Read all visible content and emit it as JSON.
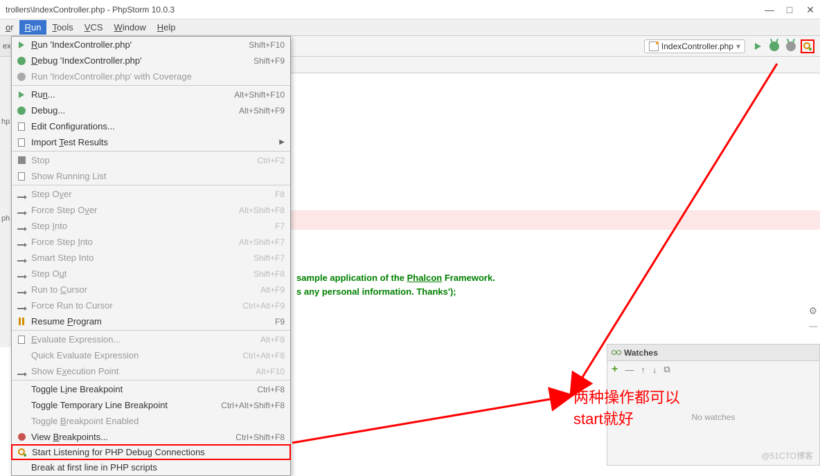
{
  "window": {
    "title": "trollers\\IndexController.php - PhpStorm 10.0.3"
  },
  "menubar": {
    "items": [
      "or",
      "Run",
      "Tools",
      "VCS",
      "Window",
      "Help"
    ],
    "active_index": 1
  },
  "toolbar": {
    "left_tab": "exC",
    "run_config": "IndexController.php"
  },
  "left_rail": {
    "labels": [
      "hp",
      "ph"
    ]
  },
  "dropdown": {
    "items": [
      {
        "icon": "play",
        "label": "Run 'IndexController.php'",
        "shortcut": "Shift+F10",
        "u": [
          0
        ]
      },
      {
        "icon": "bug",
        "label": "Debug 'IndexController.php'",
        "shortcut": "Shift+F9",
        "u": [
          0
        ]
      },
      {
        "icon": "bug-gray",
        "label": "Run 'IndexController.php' with Coverage",
        "disabled": true
      },
      {
        "sep": true
      },
      {
        "icon": "play",
        "label": "Run...",
        "shortcut": "Alt+Shift+F10",
        "u": [
          2
        ]
      },
      {
        "icon": "bug",
        "label": "Debug...",
        "shortcut": "Alt+Shift+F9",
        "u": [
          4
        ]
      },
      {
        "icon": "doc",
        "label": "Edit Configurations...",
        "u": [
          10
        ]
      },
      {
        "icon": "doc",
        "label": "Import Test Results",
        "sub": true,
        "u": [
          7
        ]
      },
      {
        "sep": true
      },
      {
        "icon": "sq",
        "label": "Stop",
        "shortcut": "Ctrl+F2",
        "disabled": true,
        "u": [
          4
        ]
      },
      {
        "icon": "doc",
        "label": "Show Running List",
        "disabled": true
      },
      {
        "sep": true
      },
      {
        "icon": "step",
        "label": "Step Over",
        "shortcut": "F8",
        "disabled": true,
        "u": [
          6
        ]
      },
      {
        "icon": "step",
        "label": "Force Step Over",
        "shortcut": "Alt+Shift+F8",
        "disabled": true,
        "u": [
          12
        ]
      },
      {
        "icon": "step",
        "label": "Step Into",
        "shortcut": "F7",
        "disabled": true,
        "u": [
          5
        ]
      },
      {
        "icon": "step",
        "label": "Force Step Into",
        "shortcut": "Alt+Shift+F7",
        "disabled": true,
        "u": [
          11
        ]
      },
      {
        "icon": "step",
        "label": "Smart Step Into",
        "shortcut": "Shift+F7",
        "disabled": true,
        "u": [
          16
        ]
      },
      {
        "icon": "step",
        "label": "Step Out",
        "shortcut": "Shift+F8",
        "disabled": true,
        "u": [
          6
        ]
      },
      {
        "icon": "step",
        "label": "Run to Cursor",
        "shortcut": "Alt+F9",
        "disabled": true,
        "u": [
          7
        ]
      },
      {
        "icon": "step",
        "label": "Force Run to Cursor",
        "shortcut": "Ctrl+Alt+F9",
        "disabled": true
      },
      {
        "icon": "pause",
        "label": "Resume Program",
        "shortcut": "F9",
        "u": [
          7
        ]
      },
      {
        "sep": true
      },
      {
        "icon": "doc",
        "label": "Evaluate Expression...",
        "shortcut": "Alt+F8",
        "disabled": true,
        "u": [
          0
        ]
      },
      {
        "icon": "",
        "label": "Quick Evaluate Expression",
        "shortcut": "Ctrl+Alt+F8",
        "disabled": true
      },
      {
        "icon": "step",
        "label": "Show Execution Point",
        "shortcut": "Alt+F10",
        "disabled": true,
        "u": [
          6
        ]
      },
      {
        "sep": true
      },
      {
        "icon": "",
        "label": "Toggle Line Breakpoint",
        "shortcut": "Ctrl+F8",
        "u": [
          8
        ]
      },
      {
        "icon": "",
        "label": "Toggle Temporary Line Breakpoint",
        "shortcut": "Ctrl+Alt+Shift+F8"
      },
      {
        "icon": "",
        "label": "Toggle Breakpoint Enabled",
        "disabled": true,
        "u": [
          7
        ]
      },
      {
        "icon": "circ",
        "label": "View Breakpoints...",
        "shortcut": "Ctrl+Shift+F8",
        "u": [
          5
        ]
      },
      {
        "icon": "phone",
        "label": "Start Listening for PHP Debug Connections",
        "boxed": true
      },
      {
        "icon": "",
        "label": "Break at first line in PHP scripts"
      }
    ]
  },
  "editor": {
    "line1_pre": " sample application of the ",
    "line1_link": "Phalcon",
    "line1_post": " Framework.",
    "line2": "s any personal information. Thanks');"
  },
  "watches": {
    "title": "Watches",
    "empty": "No watches"
  },
  "annotation": {
    "line1": "两种操作都可以",
    "line2": "start就好"
  },
  "watermark": "@51CTO博客"
}
